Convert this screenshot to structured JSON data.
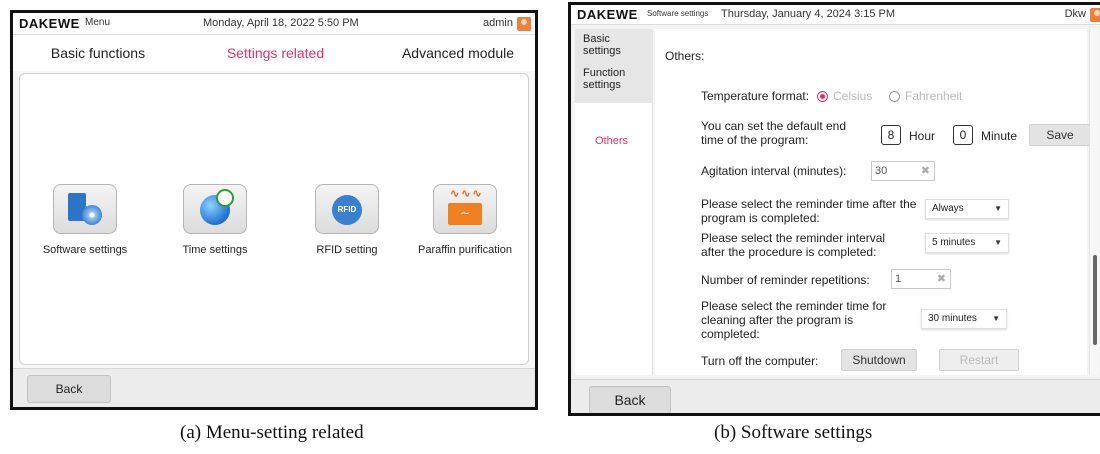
{
  "panel_a": {
    "logo": "DAKEWE",
    "menu_label": "Menu",
    "datetime": "Monday, April 18, 2022 5:50 PM",
    "user": "admin",
    "tabs": [
      {
        "label": "Basic functions"
      },
      {
        "label": "Settings related",
        "active": true
      },
      {
        "label": "Advanced module"
      }
    ],
    "apps": [
      {
        "label": "Software settings",
        "icon": "software-icon"
      },
      {
        "label": "Time settings",
        "icon": "globe-clock-icon"
      },
      {
        "label": "RFID setting",
        "icon": "rfid-icon"
      },
      {
        "label": "Paraffin purification",
        "icon": "paraffin-heater-icon"
      }
    ],
    "back_label": "Back",
    "accent_color": "#e0306a"
  },
  "panel_b": {
    "logo": "DAKEWE",
    "menu_label": "Software settings",
    "datetime": "Thursday, January 4, 2024 3:15 PM",
    "user": "Dkw",
    "sidebar": [
      {
        "label": "Basic settings"
      },
      {
        "label": "Function settings"
      },
      {
        "label": "Others",
        "active": true
      }
    ],
    "heading": "Others:",
    "temperature": {
      "label": "Temperature format:",
      "options": [
        "Celsius",
        "Fahrenheit"
      ],
      "selected": "Celsius"
    },
    "end_time": {
      "label": "You can set the default end time of the program:",
      "hour_value": "8",
      "hour_label": "Hour",
      "minute_value": "0",
      "minute_label": "Minute",
      "save_label": "Save"
    },
    "agitation": {
      "label": "Agitation interval (minutes):",
      "value": "30"
    },
    "reminder_time": {
      "label": "Please select the reminder time after the program is completed:",
      "value": "Always"
    },
    "reminder_interval": {
      "label": "Please select the reminder interval after the procedure is completed:",
      "value": "5 minutes"
    },
    "repetitions": {
      "label": "Number of reminder repetitions:",
      "value": "1"
    },
    "cleaning_time": {
      "label": "Please select the reminder time for cleaning after the program is completed:",
      "value": "30 minutes"
    },
    "power": {
      "label": "Turn off the computer:",
      "shutdown_label": "Shutdown",
      "restart_label": "Restart"
    },
    "back_label": "Back"
  },
  "captions": {
    "a": "(a) Menu-setting related",
    "b": "(b) Software settings"
  }
}
